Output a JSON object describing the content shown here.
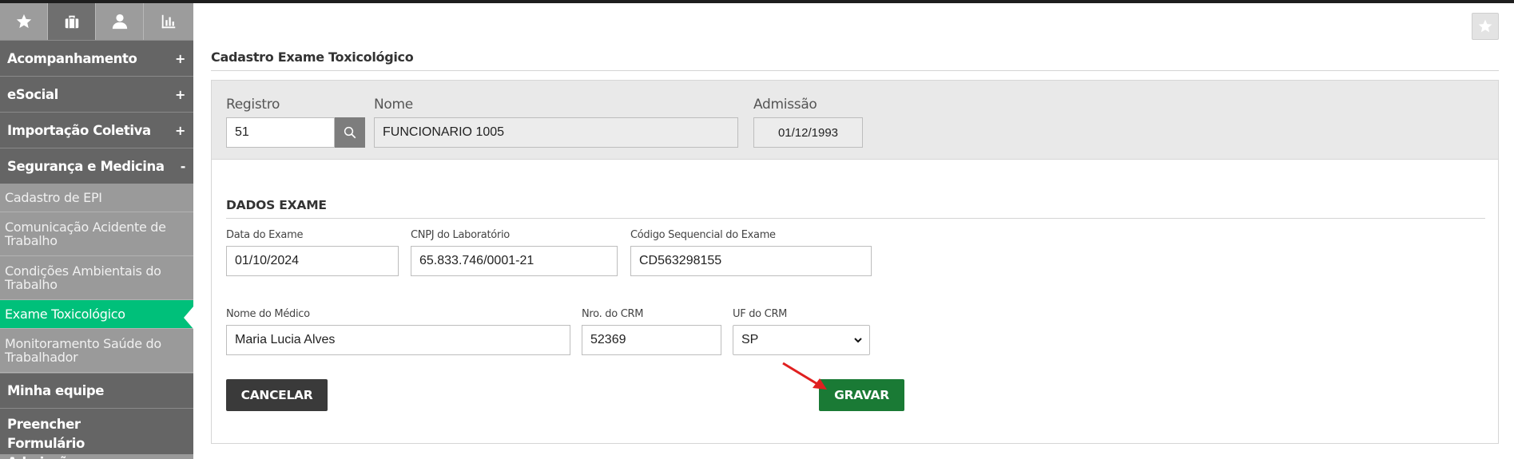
{
  "sidebar": {
    "tabs": [
      {
        "icon": "star-icon"
      },
      {
        "icon": "briefcase-icon"
      },
      {
        "icon": "user-icon"
      },
      {
        "icon": "bar-chart-icon"
      }
    ],
    "groups": [
      {
        "label": "Acompanhamento",
        "sign": "+"
      },
      {
        "label": "eSocial",
        "sign": "+"
      },
      {
        "label": "Importação Coletiva",
        "sign": "+"
      },
      {
        "label": "Segurança e Medicina",
        "sign": "-"
      }
    ],
    "sub_items": [
      {
        "label": "Cadastro de EPI"
      },
      {
        "label": "Comunicação Acidente de Trabalho"
      },
      {
        "label": "Condições Ambientais do Trabalho"
      },
      {
        "label": "Exame Toxicológico"
      },
      {
        "label": "Monitoramento Saúde do Trabalhador"
      }
    ],
    "bottom": [
      {
        "label": "Minha equipe"
      },
      {
        "label": "Preencher Formulário Admissão"
      }
    ]
  },
  "page": {
    "title": "Cadastro Exame Toxicológico"
  },
  "header": {
    "registro_label": "Registro",
    "registro_value": "51",
    "nome_label": "Nome",
    "nome_value": "FUNCIONARIO 1005",
    "admissao_label": "Admissão",
    "admissao_value": "01/12/1993"
  },
  "form": {
    "section_title": "DADOS EXAME",
    "data_exame_label": "Data do Exame",
    "data_exame_value": "01/10/2024",
    "cnpj_label": "CNPJ do Laboratório",
    "cnpj_value": "65.833.746/0001-21",
    "codigo_label": "Código Sequencial do Exame",
    "codigo_value": "CD563298155",
    "medico_label": "Nome do Médico",
    "medico_value": "Maria Lucia Alves",
    "crm_label": "Nro. do CRM",
    "crm_value": "52369",
    "uf_label": "UF do CRM",
    "uf_value": "SP"
  },
  "actions": {
    "cancel_label": "CANCELAR",
    "save_label": "GRAVAR"
  },
  "colors": {
    "active_item": "#00c07a",
    "save_button": "#1a7a35",
    "cancel_button": "#3a3a3a",
    "menu_head": "#656565",
    "annotation_arrow": "#e02020"
  }
}
